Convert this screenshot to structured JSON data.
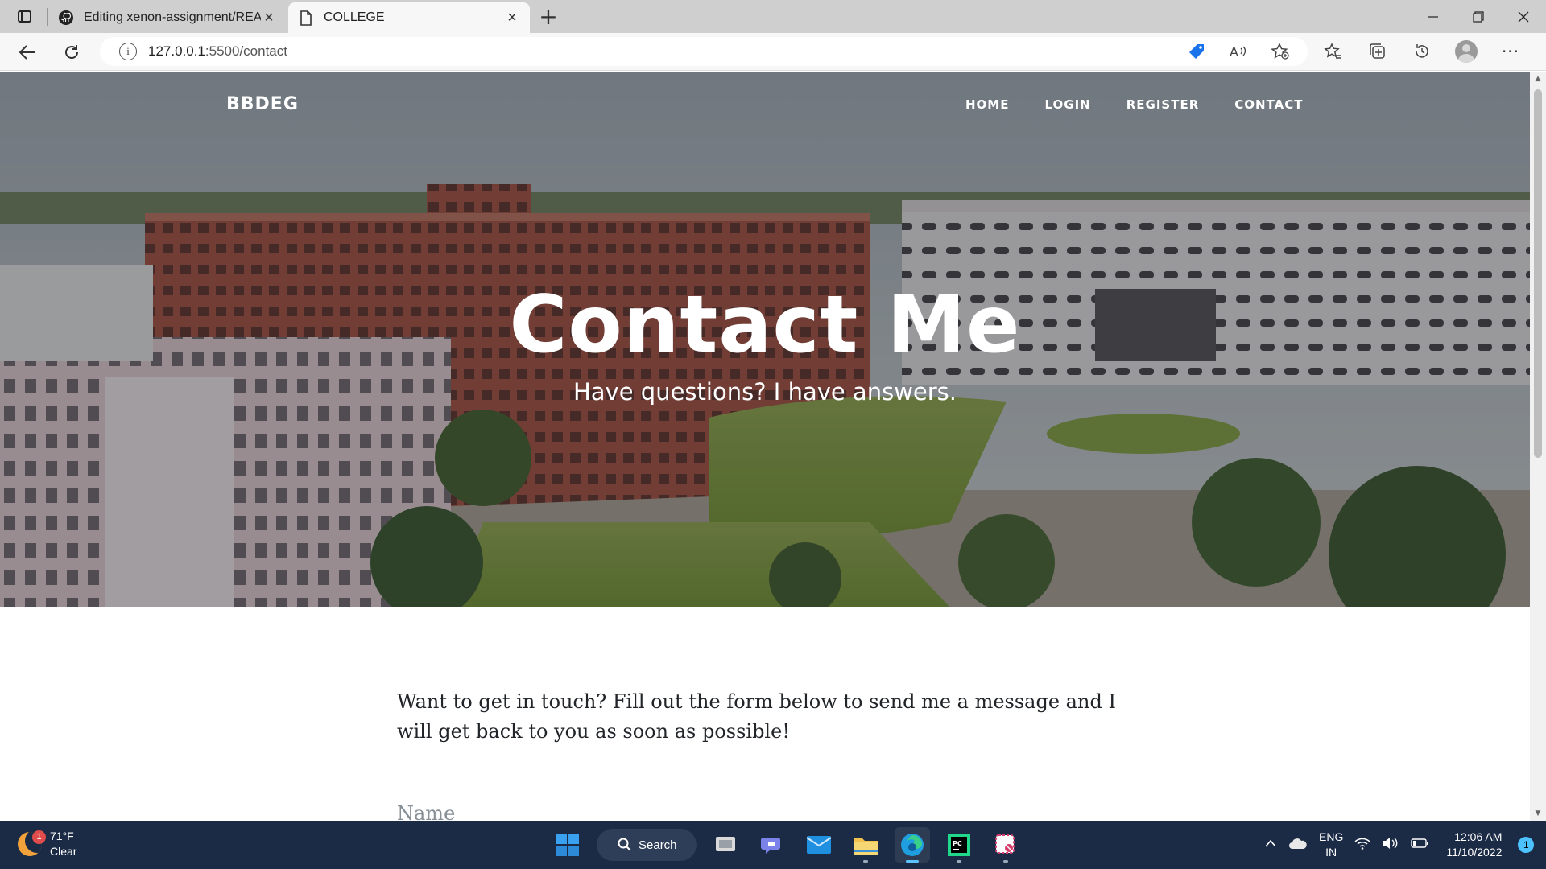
{
  "browser": {
    "tabs": [
      {
        "title": "Editing xenon-assignment/READ",
        "icon": "github-icon",
        "active": false
      },
      {
        "title": "COLLEGE",
        "icon": "page-icon",
        "active": true
      }
    ],
    "url_host": "127.0.0.1",
    "url_path": ":5500/contact"
  },
  "site": {
    "brand": "BBDEG",
    "nav": [
      "HOME",
      "LOGIN",
      "REGISTER",
      "CONTACT"
    ],
    "hero_title": "Contact Me",
    "hero_subtitle": "Have questions? I have answers.",
    "intro_text": "Want to get in touch? Fill out the form below to send me a message and I will get back to you as soon as possible!",
    "name_label": "Name"
  },
  "taskbar": {
    "weather_temp": "71°F",
    "weather_desc": "Clear",
    "weather_badge": "1",
    "search_label": "Search",
    "lang_line1": "ENG",
    "lang_line2": "IN",
    "time": "12:06 AM",
    "date": "11/10/2022",
    "notification_count": "1"
  },
  "colors": {
    "hero_overlay": "#212529",
    "taskbar": "#1c2b45",
    "body_text": "#212529",
    "muted_text": "#868e96"
  }
}
